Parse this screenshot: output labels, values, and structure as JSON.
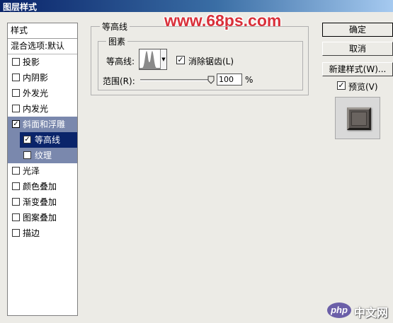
{
  "window": {
    "title": "图层样式"
  },
  "watermark": "www.68ps.com",
  "styles": {
    "header": "样式",
    "blend_options": "混合选项:默认",
    "items": [
      {
        "label": "投影",
        "checked": false
      },
      {
        "label": "内阴影",
        "checked": false
      },
      {
        "label": "外发光",
        "checked": false
      },
      {
        "label": "内发光",
        "checked": false
      },
      {
        "label": "斜面和浮雕",
        "checked": true
      },
      {
        "label": "等高线",
        "checked": true
      },
      {
        "label": "纹理",
        "checked": false
      },
      {
        "label": "光泽",
        "checked": false
      },
      {
        "label": "颜色叠加",
        "checked": false
      },
      {
        "label": "渐变叠加",
        "checked": false
      },
      {
        "label": "图案叠加",
        "checked": false
      },
      {
        "label": "描边",
        "checked": false
      }
    ]
  },
  "contour_section": {
    "title": "等高线",
    "group_title": "图素",
    "contour_label": "等高线:",
    "anti_alias_label": "消除锯齿(L)",
    "anti_alias_checked": true,
    "range_label": "范围(R):",
    "range_value": "100",
    "range_unit": "%",
    "range_fraction": 1.0
  },
  "buttons": {
    "ok": "确定",
    "cancel": "取消",
    "new_style": "新建样式(W)...",
    "preview_label": "预览(V)",
    "preview_checked": true
  },
  "badge": {
    "logo": "php",
    "text": "中文网"
  },
  "colors": {
    "selected_row": "#7a88ad",
    "active_row": "#0a246a",
    "watermark": "#d9303a",
    "titlebar_start": "#0a246a"
  }
}
